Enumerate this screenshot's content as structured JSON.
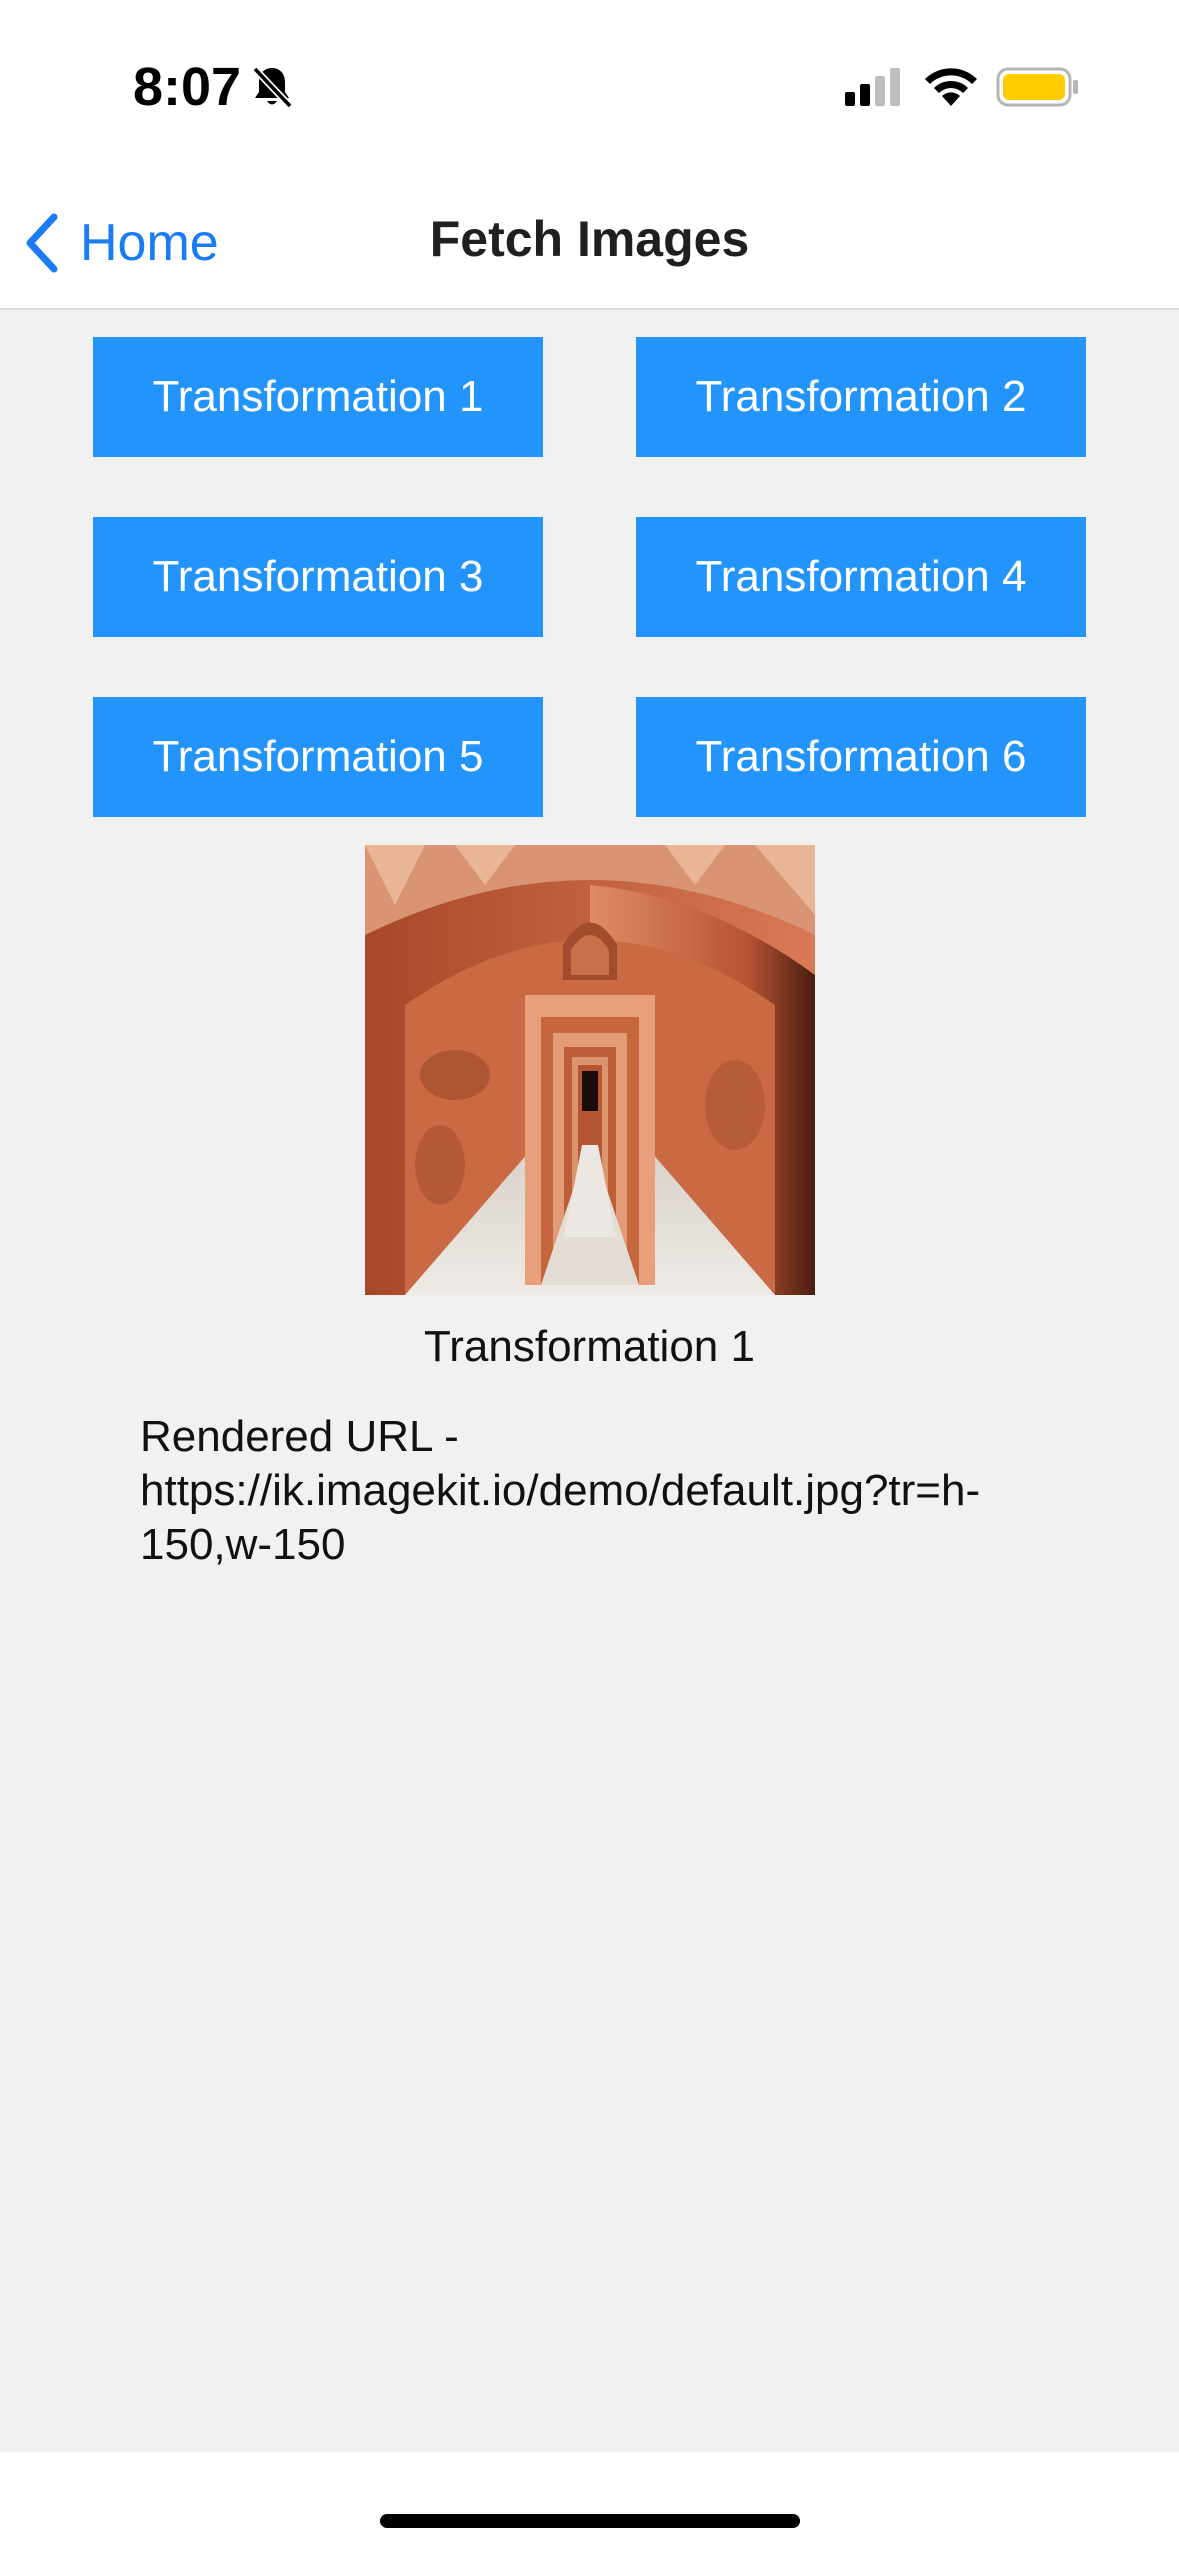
{
  "status_bar": {
    "time": "8:07",
    "icons": [
      "bell-slash-icon",
      "cellular-signal-icon",
      "wifi-icon",
      "battery-icon"
    ],
    "battery_color": "#ffcc00"
  },
  "nav": {
    "back_label": "Home",
    "title": "Fetch Images"
  },
  "buttons": [
    {
      "label": "Transformation 1"
    },
    {
      "label": "Transformation 2"
    },
    {
      "label": "Transformation 3"
    },
    {
      "label": "Transformation 4"
    },
    {
      "label": "Transformation 5"
    },
    {
      "label": "Transformation 6"
    }
  ],
  "result": {
    "caption": "Transformation 1",
    "url_line": "Rendered URL - https://ik.imagekit.io/demo/default.jpg?tr=h-150,w-150"
  },
  "colors": {
    "accent": "#1a7cf5",
    "button_bg": "#2294fb",
    "background": "#f1f1f1"
  }
}
